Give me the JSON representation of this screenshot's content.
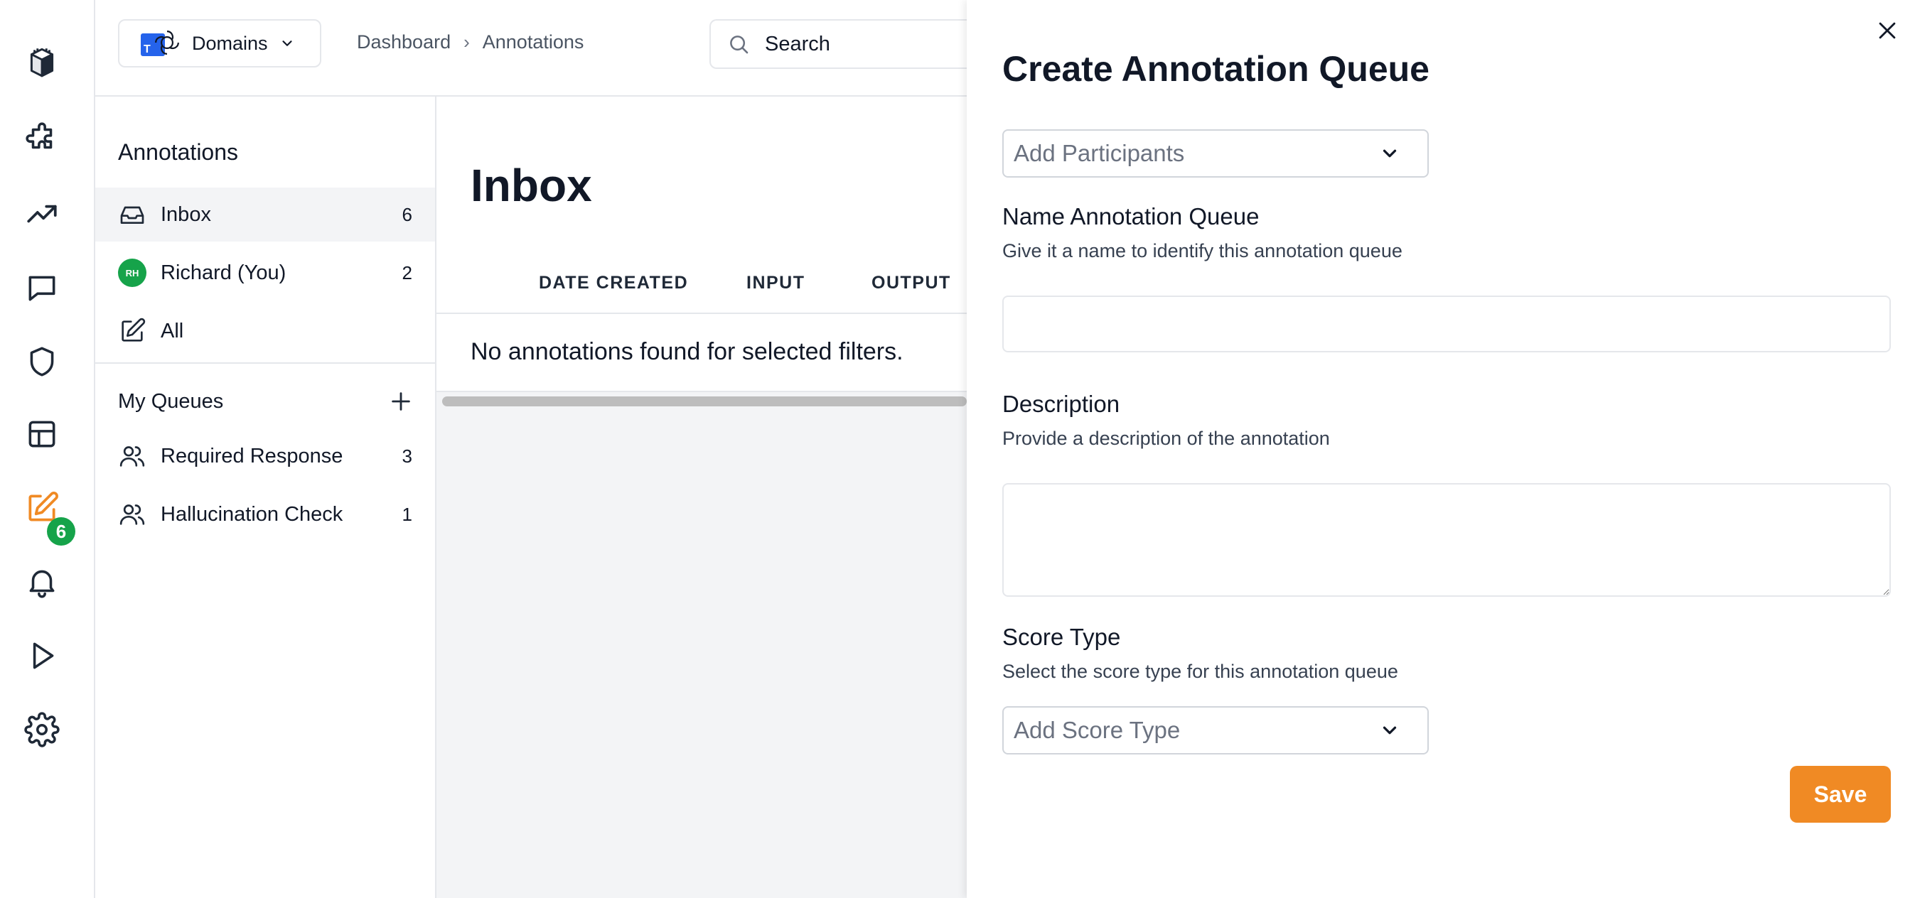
{
  "rail": {
    "items": [
      {
        "icon": "castle-logo-icon"
      },
      {
        "icon": "puzzle-icon"
      },
      {
        "icon": "trending-up-icon"
      },
      {
        "icon": "message-icon"
      },
      {
        "icon": "shield-icon"
      },
      {
        "icon": "table-icon"
      },
      {
        "icon": "edit-icon",
        "badge": "6"
      },
      {
        "icon": "bell-icon"
      },
      {
        "icon": "play-icon"
      },
      {
        "icon": "gear-icon"
      }
    ],
    "accent": "#f08a24",
    "badge_color": "#16a34a"
  },
  "header": {
    "domains_label": "Domains",
    "domains_logo_text": "T",
    "breadcrumb": [
      "Dashboard",
      "Annotations"
    ],
    "search_placeholder": "Search"
  },
  "sidebar": {
    "title": "Annotations",
    "items": [
      {
        "label": "Inbox",
        "count": "6",
        "icon": "inbox-icon"
      },
      {
        "label": "Richard (You)",
        "count": "2",
        "avatar": "RH"
      },
      {
        "label": "All",
        "icon": "edit-icon"
      }
    ],
    "queues_title": "My Queues",
    "queues": [
      {
        "label": "Required Response",
        "count": "3",
        "icon": "users-icon"
      },
      {
        "label": "Hallucination Check",
        "count": "1",
        "icon": "users-icon"
      }
    ]
  },
  "main": {
    "title": "Inbox",
    "columns": [
      "DATE CREATED",
      "INPUT",
      "OUTPUT"
    ],
    "empty_message": "No annotations found for selected filters."
  },
  "drawer": {
    "title": "Create Annotation Queue",
    "participants_placeholder": "Add Participants",
    "name_label": "Name Annotation Queue",
    "name_help": "Give it a name to identify this annotation queue",
    "name_value": "",
    "description_label": "Description",
    "description_help": "Provide a description of the annotation",
    "description_value": "",
    "score_label": "Score Type",
    "score_help": "Select the score type for this annotation queue",
    "score_placeholder": "Add Score Type",
    "save_label": "Save",
    "save_color": "#f08a24"
  }
}
